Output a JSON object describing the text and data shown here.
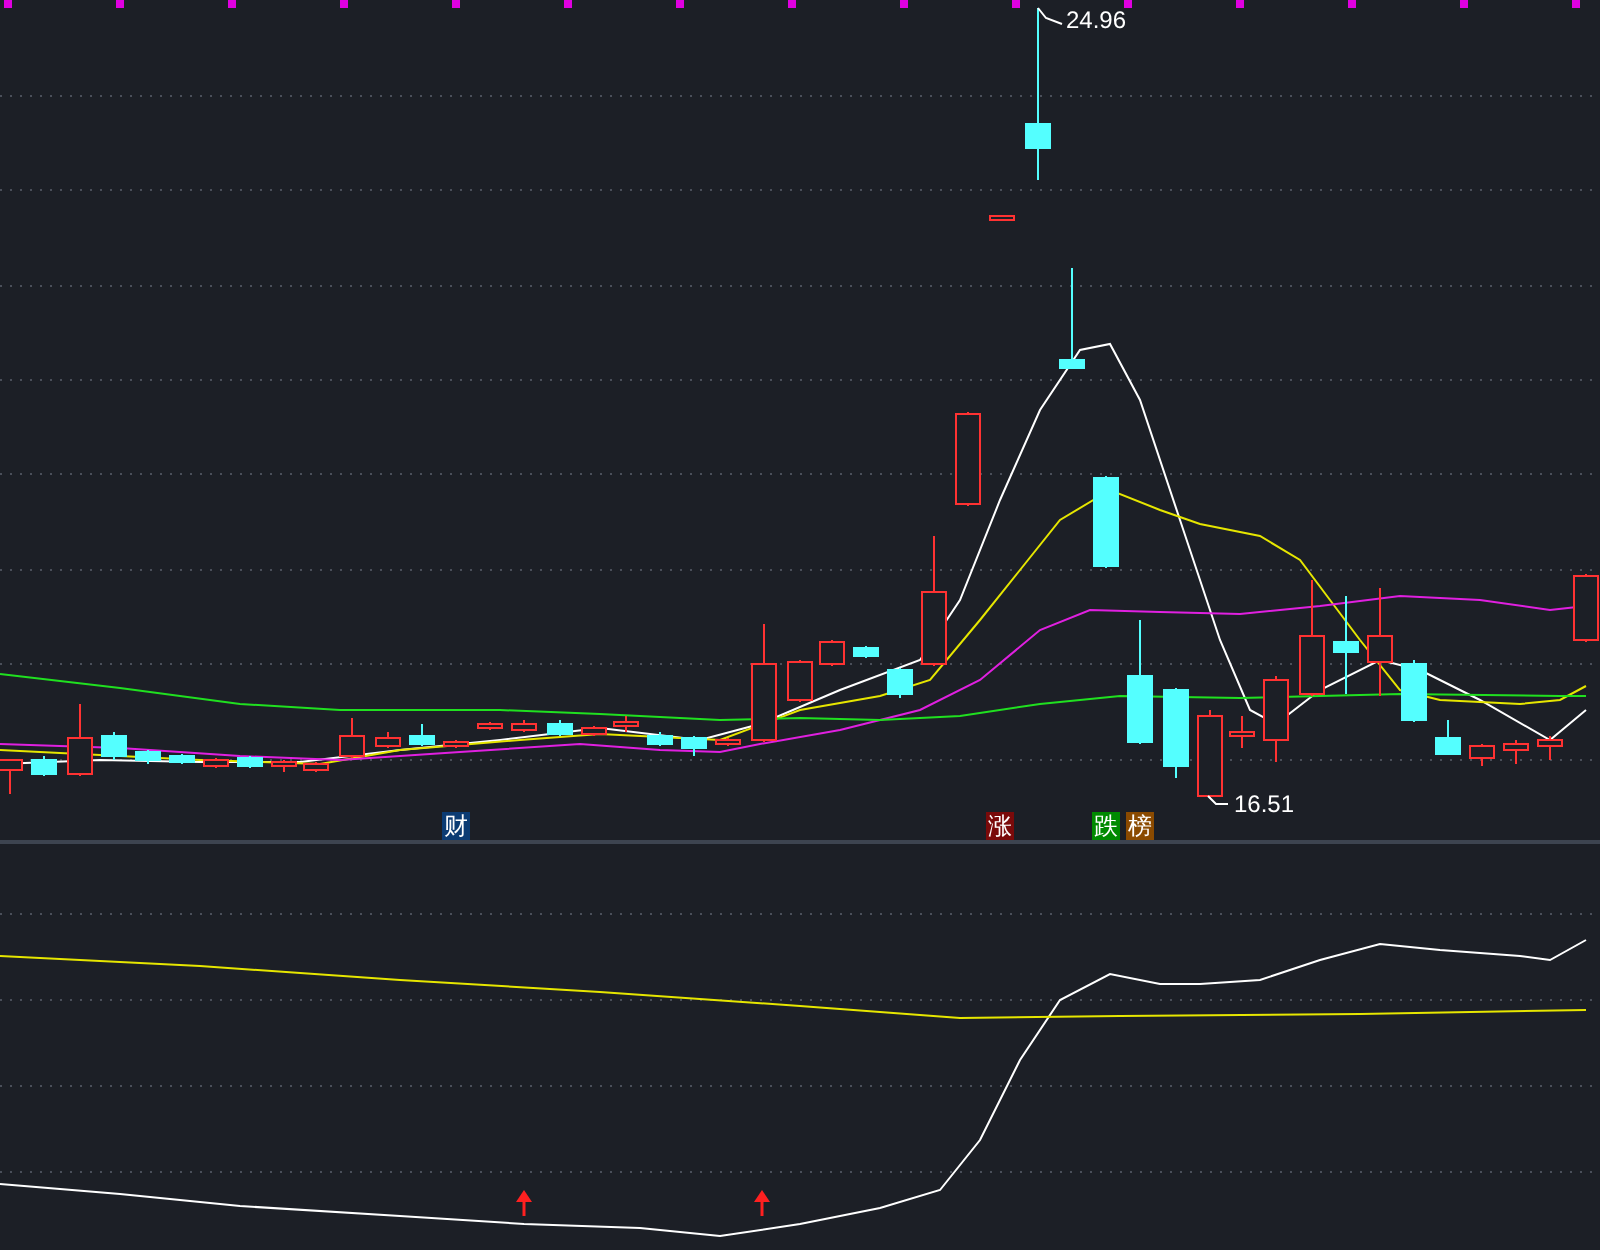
{
  "price_chart": {
    "high_label": "24.96",
    "low_label": "16.51",
    "markers": [
      {
        "text": "财",
        "color": "#0b3b73"
      },
      {
        "text": "涨",
        "color": "#7a0a0a"
      },
      {
        "text": "跌",
        "color": "#008a00"
      },
      {
        "text": "榜",
        "color": "#8a4a00"
      }
    ]
  }
}
